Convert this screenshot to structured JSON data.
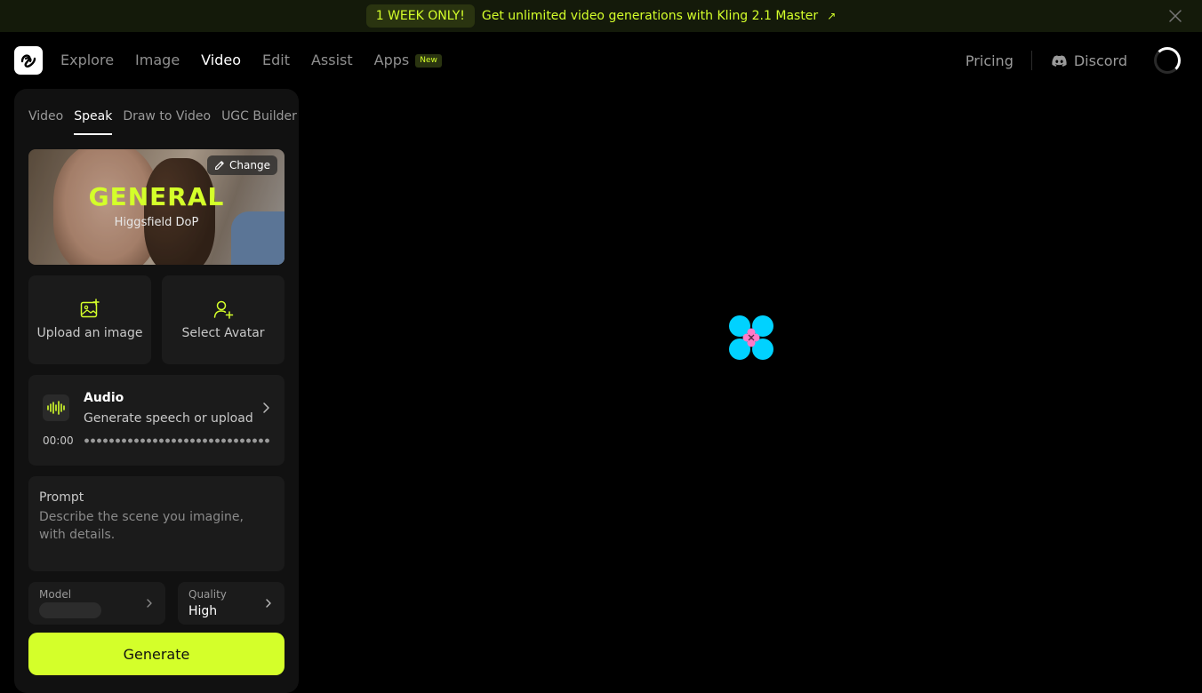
{
  "banner": {
    "badge": "1 WEEK ONLY!",
    "text": "Get unlimited video generations with Kling 2.1 Master",
    "arrow": "↗"
  },
  "nav": {
    "links": [
      {
        "label": "Explore",
        "active": false
      },
      {
        "label": "Image",
        "active": false
      },
      {
        "label": "Video",
        "active": true
      },
      {
        "label": "Edit",
        "active": false
      },
      {
        "label": "Assist",
        "active": false
      },
      {
        "label": "Apps",
        "active": false
      }
    ],
    "new_badge": "New",
    "pricing": "Pricing",
    "discord": "Discord"
  },
  "panel": {
    "tabs": [
      {
        "label": "Video",
        "active": false
      },
      {
        "label": "Speak",
        "active": true
      },
      {
        "label": "Draw to Video",
        "active": false
      },
      {
        "label": "UGC Builder",
        "active": false
      }
    ],
    "preview": {
      "title": "GENERAL",
      "subtitle": "Higgsfield DoP",
      "change_label": "Change"
    },
    "upload_label": "Upload an image",
    "avatar_label": "Select Avatar",
    "audio": {
      "title": "Audio",
      "subtitle": "Generate speech or upload",
      "time": "00:00"
    },
    "prompt": {
      "label": "Prompt",
      "placeholder": "Describe the scene you imagine, with details."
    },
    "model": {
      "label": "Model",
      "value": ""
    },
    "quality": {
      "label": "Quality",
      "value": "High"
    },
    "generate_label": "Generate"
  },
  "colors": {
    "accent": "#d4ff2a",
    "panel_bg": "#111111",
    "card_bg": "#1b1b1b",
    "loader_petal": "#00d2ff",
    "loader_center": "#ff7ac8"
  }
}
